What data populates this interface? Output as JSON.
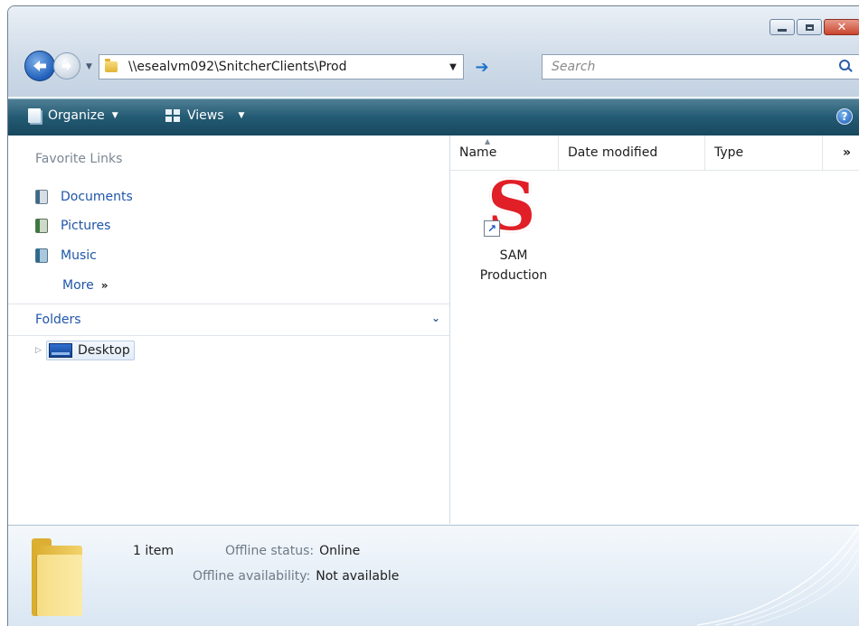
{
  "window": {
    "controls": {
      "minimize_icon": "minimize-icon",
      "maximize_icon": "maximize-icon",
      "close_icon": "close-icon",
      "close_glyph": "✕"
    }
  },
  "nav": {
    "address": "\\\\esealvm092\\SnitcherClients\\Prod",
    "search_placeholder": "Search"
  },
  "commandbar": {
    "organize": "Organize",
    "views": "Views",
    "help": "?"
  },
  "nav_pane": {
    "favorites_header": "Favorite Links",
    "favorites": [
      "Documents",
      "Pictures",
      "Music"
    ],
    "more": "More",
    "folders_label": "Folders",
    "tree": [
      {
        "label": "Desktop"
      }
    ]
  },
  "columns": [
    "Name",
    "Date modified",
    "Type"
  ],
  "files": [
    {
      "name_line1": "SAM",
      "name_line2": "Production",
      "icon": "sam-shortcut-icon"
    }
  ],
  "details": {
    "count": "1 item",
    "offline_status_label": "Offline status:",
    "offline_status_value": "Online",
    "offline_avail_label": "Offline availability:",
    "offline_avail_value": "Not available"
  }
}
